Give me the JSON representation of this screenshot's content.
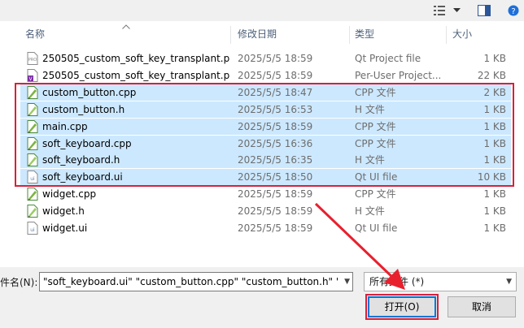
{
  "toolbar": {
    "view_icon": "view-details-icon",
    "dropdown_icon": "chevron-down-icon",
    "preview_icon": "preview-pane-icon"
  },
  "columns": {
    "name": "名称",
    "date": "修改日期",
    "type": "类型",
    "size": "大小"
  },
  "files": [
    {
      "name": "250505_custom_soft_key_transplant.p...",
      "date": "2025/5/5 18:59",
      "type": "Qt Project file",
      "size": "1 KB",
      "icon": "pro-file-icon",
      "selected": false
    },
    {
      "name": "250505_custom_soft_key_transplant.p...",
      "date": "2025/5/5 18:59",
      "type": "Per-User Project...",
      "size": "22 KB",
      "icon": "user-project-file-icon",
      "selected": false
    },
    {
      "name": "custom_button.cpp",
      "date": "2025/5/5 18:47",
      "type": "CPP 文件",
      "size": "2 KB",
      "icon": "cpp-file-icon",
      "selected": true
    },
    {
      "name": "custom_button.h",
      "date": "2025/5/5 16:53",
      "type": "H 文件",
      "size": "1 KB",
      "icon": "header-file-icon",
      "selected": true
    },
    {
      "name": "main.cpp",
      "date": "2025/5/5 18:59",
      "type": "CPP 文件",
      "size": "1 KB",
      "icon": "cpp-file-icon",
      "selected": true
    },
    {
      "name": "soft_keyboard.cpp",
      "date": "2025/5/5 16:36",
      "type": "CPP 文件",
      "size": "1 KB",
      "icon": "cpp-file-icon",
      "selected": true
    },
    {
      "name": "soft_keyboard.h",
      "date": "2025/5/5 16:35",
      "type": "H 文件",
      "size": "1 KB",
      "icon": "header-file-icon",
      "selected": true
    },
    {
      "name": "soft_keyboard.ui",
      "date": "2025/5/5 18:50",
      "type": "Qt UI file",
      "size": "10 KB",
      "icon": "ui-file-icon",
      "selected": true
    },
    {
      "name": "widget.cpp",
      "date": "2025/5/5 18:59",
      "type": "CPP 文件",
      "size": "1 KB",
      "icon": "cpp-file-icon",
      "selected": false
    },
    {
      "name": "widget.h",
      "date": "2025/5/5 18:59",
      "type": "H 文件",
      "size": "1 KB",
      "icon": "header-file-icon",
      "selected": false
    },
    {
      "name": "widget.ui",
      "date": "2025/5/5 18:59",
      "type": "Qt UI file",
      "size": "1 KB",
      "icon": "ui-file-icon",
      "selected": false
    }
  ],
  "filename": {
    "label": "件名(N):",
    "value": "\"soft_keyboard.ui\" \"custom_button.cpp\" \"custom_button.h\" \"sof"
  },
  "filetype": {
    "value": "所有文件 (*)"
  },
  "buttons": {
    "open": "打开(O)",
    "cancel": "取消"
  },
  "colors": {
    "selection": "#cce8ff",
    "highlight_box": "#d8203a",
    "accent": "#0078d7"
  }
}
